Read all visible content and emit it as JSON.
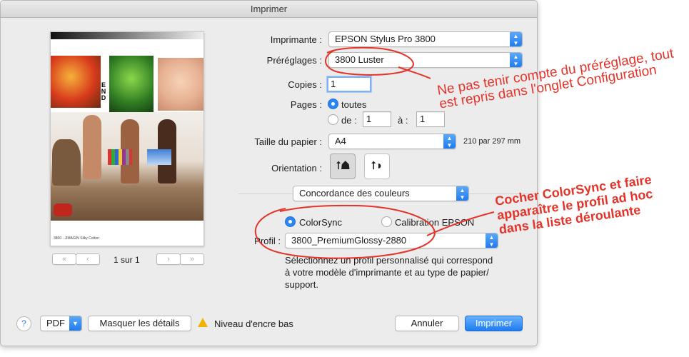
{
  "window": {
    "title": "Imprimer"
  },
  "form": {
    "printer_label": "Imprimante :",
    "printer_value": "EPSON Stylus Pro 3800",
    "presets_label": "Préréglages :",
    "presets_value": "3800 Luster",
    "copies_label": "Copies :",
    "copies_value": "1",
    "pages_label": "Pages :",
    "pages_all": "toutes",
    "pages_from_label": "de :",
    "pages_from_value": "1",
    "pages_to_label": "à :",
    "pages_to_value": "1",
    "paper_label": "Taille du papier :",
    "paper_value": "A4",
    "paper_dims": "210 par 297 mm",
    "orientation_label": "Orientation :",
    "section_value": "Concordance des couleurs",
    "colorsync_label": "ColorSync",
    "epson_label": "Calibration EPSON",
    "profile_label": "Profil :",
    "profile_value": "3800_PremiumGlossy-2880",
    "description_line1": "Sélectionnez un profil personnalisé qui correspond",
    "description_line2": "à votre modèle d'imprimante et au type de papier/",
    "description_line3": "support."
  },
  "preview": {
    "caption": "3800 - JIMAGIN Silky Cotton",
    "page_indicator": "1 sur 1",
    "first_label": "«",
    "prev_label": "‹",
    "next_label": "›",
    "last_label": "»"
  },
  "footer": {
    "help_label": "?",
    "pdf_label": "PDF",
    "hide_details_label": "Masquer les détails",
    "ink_warning": "Niveau d'encre bas",
    "cancel_label": "Annuler",
    "print_label": "Imprimer"
  },
  "annotations": {
    "note1_line1": "Ne pas tenir compte du préréglage, tout",
    "note1_line2": "est repris dans l'onglet Configuration",
    "note2_line1": "Cocher ColorSync et faire",
    "note2_line2": "apparaître le profil ad hoc",
    "note2_line3": "dans la liste déroulante"
  },
  "colors": {
    "accent": "#1f7cf0",
    "annotation_red": "#e4342a",
    "dialog_bg": "#ececec"
  }
}
